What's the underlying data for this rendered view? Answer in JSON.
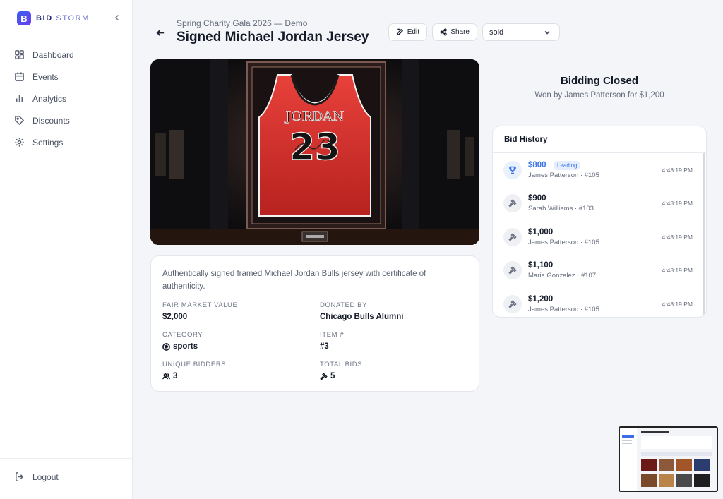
{
  "brand": {
    "bold": "BID",
    "light": "STORM"
  },
  "sidebar": {
    "items": [
      {
        "label": "Dashboard",
        "icon": "grid-icon"
      },
      {
        "label": "Events",
        "icon": "calendar-icon"
      },
      {
        "label": "Analytics",
        "icon": "bar-chart-icon"
      },
      {
        "label": "Discounts",
        "icon": "tag-icon"
      },
      {
        "label": "Settings",
        "icon": "gear-icon"
      }
    ],
    "logout_label": "Logout"
  },
  "header": {
    "breadcrumb": "Spring Charity Gala 2026 — Demo",
    "title": "Signed Michael Jordan Jersey",
    "edit_label": "Edit",
    "share_label": "Share",
    "status_value": "sold"
  },
  "hero": {
    "jersey_name": "JORDAN",
    "jersey_number": "23",
    "jersey_color": "#d6302e"
  },
  "details": {
    "description": "Authentically signed framed Michael Jordan Bulls jersey with certificate of authenticity.",
    "fair_market_value_label": "FAIR MARKET VALUE",
    "fair_market_value": "$2,000",
    "donated_by_label": "DONATED BY",
    "donated_by": "Chicago Bulls Alumni",
    "category_label": "CATEGORY",
    "category": "sports",
    "item_number_label": "ITEM #",
    "item_number": "#3",
    "unique_bidders_label": "UNIQUE BIDDERS",
    "unique_bidders": "3",
    "total_bids_label": "TOTAL BIDS",
    "total_bids": "5"
  },
  "closed": {
    "title": "Bidding Closed",
    "subtitle": "Won by James Patterson for $1,200"
  },
  "history": {
    "title": "Bid History",
    "leading_label": "Leading",
    "bids": [
      {
        "amount": "$800",
        "bidder": "James Patterson · #105",
        "time": "4:48:19 PM",
        "leading": true
      },
      {
        "amount": "$900",
        "bidder": "Sarah Williams · #103",
        "time": "4:48:19 PM",
        "leading": false
      },
      {
        "amount": "$1,000",
        "bidder": "James Patterson · #105",
        "time": "4:48:19 PM",
        "leading": false
      },
      {
        "amount": "$1,100",
        "bidder": "Maria Gonzalez · #107",
        "time": "4:48:19 PM",
        "leading": false
      },
      {
        "amount": "$1,200",
        "bidder": "James Patterson · #105",
        "time": "4:48:19 PM",
        "leading": false
      }
    ]
  },
  "colors": {
    "accent": "#3d74e8",
    "brand": "#3a5cf0"
  }
}
